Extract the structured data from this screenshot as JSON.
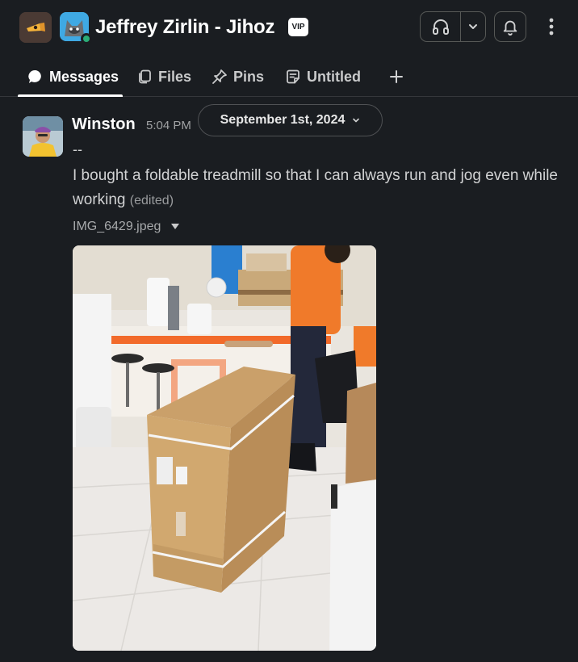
{
  "header": {
    "workspace_icon": "workspace-logo-icon",
    "dm_avatar_icon": "fox-avatar-icon",
    "title": "Jeffrey Zirlin - Jihoz",
    "badge": "VIP",
    "huddle_icon": "headphones-icon",
    "huddle_menu_icon": "chevron-down-icon",
    "notifications_icon": "bell-icon",
    "more_icon": "more-vertical-icon"
  },
  "tabs": [
    {
      "label": "Messages",
      "icon": "chat-bubble-icon",
      "active": true
    },
    {
      "label": "Files",
      "icon": "files-icon",
      "active": false
    },
    {
      "label": "Pins",
      "icon": "pin-icon",
      "active": false
    },
    {
      "label": "Untitled",
      "icon": "canvas-icon",
      "active": false
    }
  ],
  "add_tab_icon": "plus-icon",
  "date_divider": {
    "label": "September 1st, 2024",
    "icon": "chevron-down-icon"
  },
  "message": {
    "sender": "Winston",
    "time": "5:04 PM",
    "line1": "--",
    "text": "I bought a foldable treadmill so that I can always run and jog even while working",
    "edited": "(edited)",
    "attachment": {
      "file_name": "IMG_6429.jpeg",
      "toggle_icon": "caret-down-icon",
      "image_subject": "cardboard-box-photo"
    }
  },
  "colors": {
    "background": "#1a1d21",
    "text": "#d1d2d3",
    "presence": "#2bac76",
    "dm_avatar_bg": "#3fa9e3"
  }
}
